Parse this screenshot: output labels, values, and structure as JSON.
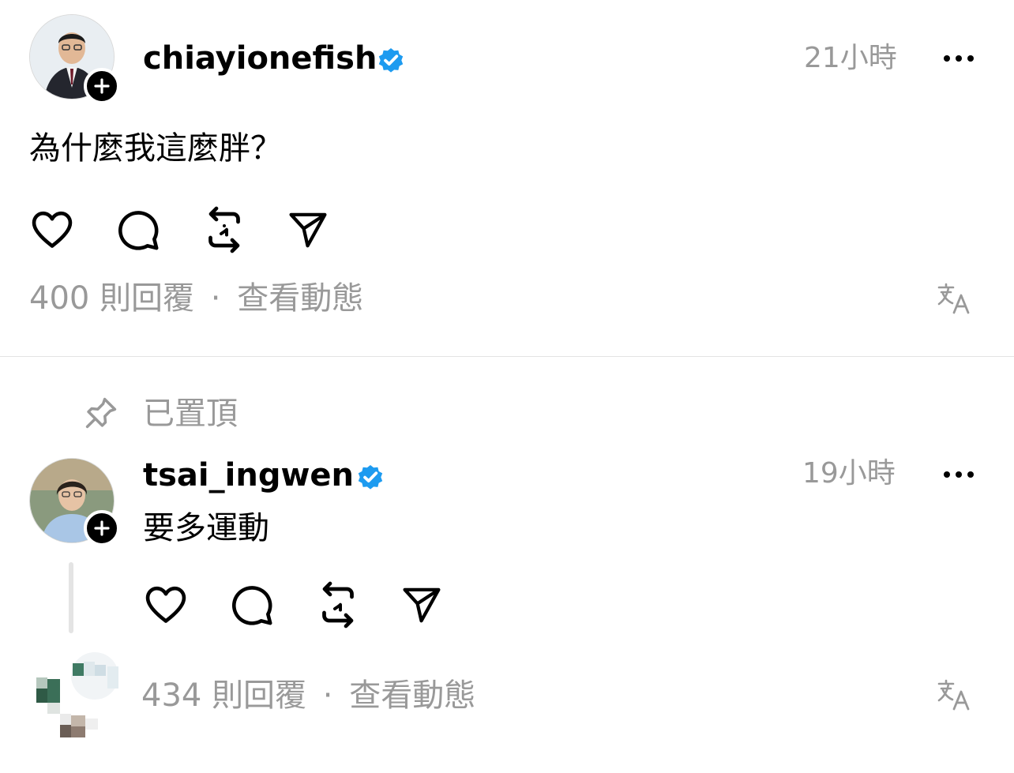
{
  "colors": {
    "accent": "#1D9BF0",
    "muted": "#999999",
    "text": "#000000"
  },
  "post": {
    "username": "chiayionefish",
    "time": "21小時",
    "text": "為什麼我這麼胖？",
    "replies": "400 則回覆",
    "separator": "·",
    "activity": "查看動態",
    "icons": [
      "heart-icon",
      "comment-icon",
      "repost-icon",
      "share-icon",
      "translate-icon",
      "more-icon"
    ]
  },
  "pinned_label": "已置頂",
  "reply": {
    "username": "tsai_ingwen",
    "time": "19小時",
    "text": "要多運動",
    "replies": "434 則回覆",
    "separator": "·",
    "activity": "查看動態"
  }
}
